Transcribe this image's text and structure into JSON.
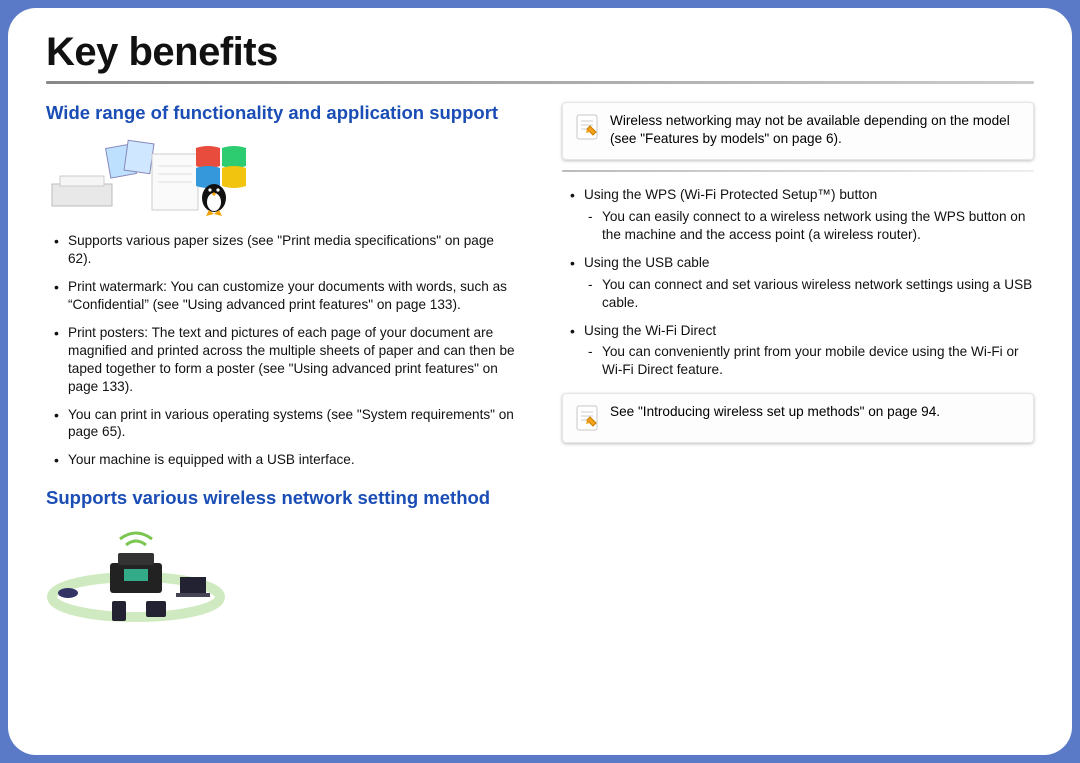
{
  "title": "Key benefits",
  "left": {
    "section1_heading": "Wide range of functionality and application support",
    "bullets": [
      "Supports various paper sizes (see \"Print media specifications\" on page 62).",
      "Print watermark: You can customize your documents with words, such as “Confidential” (see \"Using advanced print features\" on page 133).",
      "Print posters: The text and pictures of each page of your document are magnified and printed across the multiple sheets of paper and can then be taped together to form a poster (see \"Using advanced print features\" on page 133).",
      "You can print in various operating systems (see \"System requirements\" on page 65).",
      "Your machine is equipped with a USB interface."
    ],
    "section2_heading": "Supports various wireless network setting method"
  },
  "right": {
    "note1": "Wireless networking may not be available depending on the model (see \"Features by models\" on page 6).",
    "bullets": [
      {
        "text": "Using the WPS (Wi-Fi Protected Setup™) button",
        "sub": [
          "You can easily connect to a wireless network using the WPS button on the machine and the access point (a wireless router)."
        ]
      },
      {
        "text": "Using the USB cable",
        "sub": [
          "You can connect and set various wireless network settings using a USB cable."
        ]
      },
      {
        "text": "Using the Wi-Fi Direct",
        "sub": [
          "You can conveniently print from your mobile device using the Wi-Fi or Wi-Fi Direct feature."
        ]
      }
    ],
    "note2": "See \"Introducing wireless set up methods\" on page 94."
  }
}
